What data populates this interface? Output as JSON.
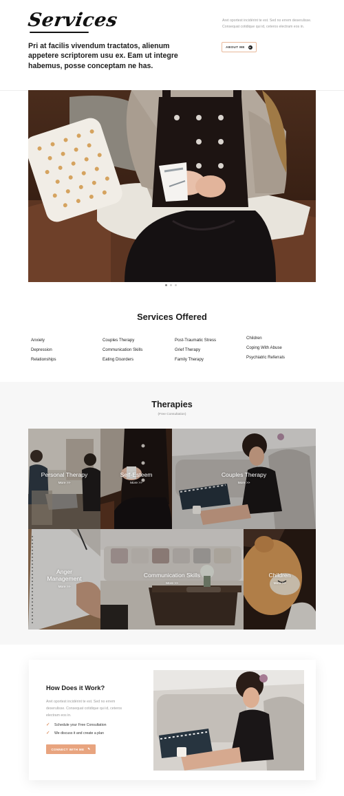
{
  "header": {
    "title": "Services",
    "lead": "Pri at facilis vivendum tractatos, alienum appetere scriptorem usu ex. Eam ut integre habemus, posse conceptam ne has.",
    "side_text": "Aret oportest incidérint te est. Sed no errem deserulisse. Consequat cotidique qui id, ceteros electram eos in.",
    "about_button": "ABOUT ME"
  },
  "hero": {
    "slides_count": 3,
    "active_slide": 1
  },
  "services": {
    "title": "Services Offered",
    "columns": [
      [
        "Anxiety",
        "Depression",
        "Relationships"
      ],
      [
        "Couples Therapy",
        "Communication Skills",
        "Eating Disorders"
      ],
      [
        "Post-Traumatic Stress",
        "Grief Therapy",
        "Family Therapy"
      ],
      [
        "Children",
        "Coping With Abuse",
        "Psychiatric Referrals"
      ]
    ]
  },
  "therapies": {
    "title": "Therapies",
    "subtitle": "(Free Consultation)",
    "tiles": [
      {
        "label": "Personal Therapy",
        "more": "More >>"
      },
      {
        "label": "Self-Esteem",
        "more": "More >>"
      },
      {
        "label": "Couples Therapy",
        "more": "More >>"
      },
      {
        "label_line1": "Anger",
        "label_line2": "Management",
        "more": "More >>"
      },
      {
        "label": "Communication Skills",
        "more": "More >>"
      },
      {
        "label": "Children",
        "more": "More >>"
      }
    ]
  },
  "how": {
    "title": "How Does it Work?",
    "text": "Aret oportest incidérint te est. Sed no errem deserulisse. Consequat cotidique qui id, ceteros electram eos in.",
    "steps": [
      "Schedule your Free Consultation",
      "We discuss it and create a plan"
    ],
    "button": "CONNECT WITH ME"
  },
  "colors": {
    "accent": "#e8a47f",
    "outline": "#e8b89a",
    "section_bg": "#f7f7f7"
  }
}
